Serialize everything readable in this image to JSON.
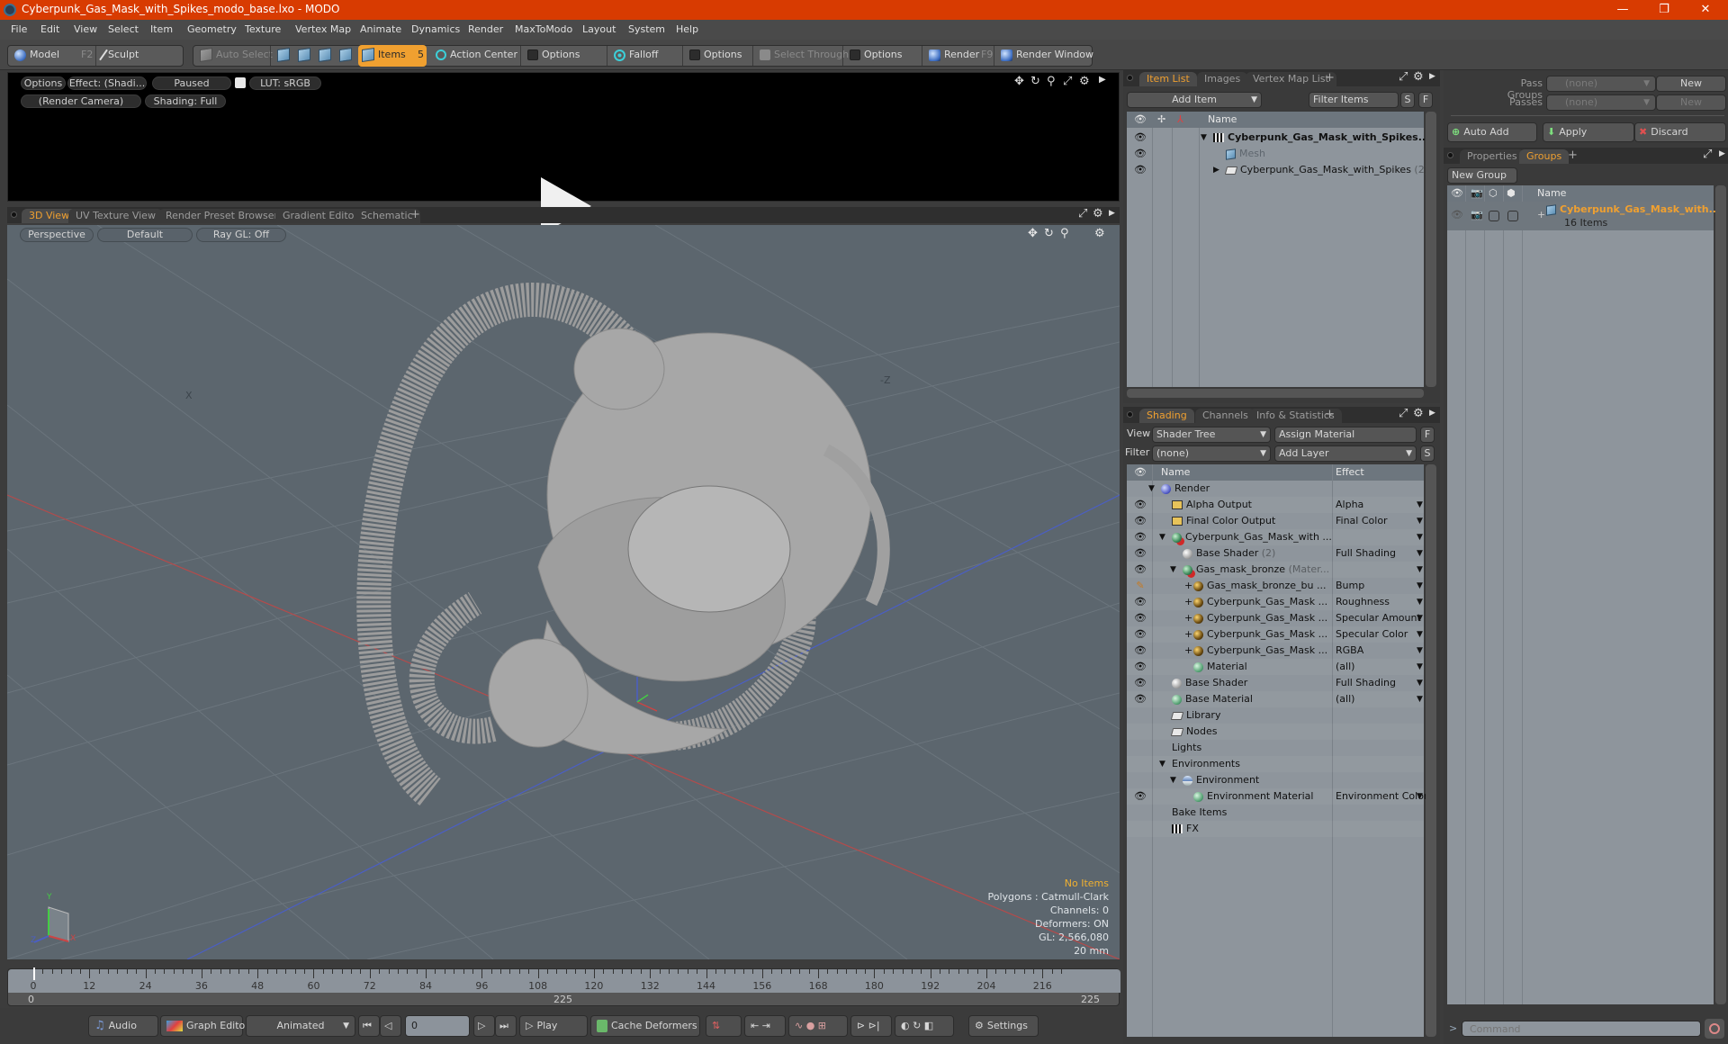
{
  "window": {
    "title": "Cyberpunk_Gas_Mask_with_Spikes_modo_base.lxo - MODO",
    "controls": {
      "minimize": "—",
      "restore": "❐",
      "close": "✕"
    }
  },
  "menu": [
    "File",
    "Edit",
    "View",
    "Select",
    "Item",
    "Geometry",
    "Texture",
    "Vertex Map",
    "Animate",
    "Dynamics",
    "Render",
    "MaxToModo",
    "Layout",
    "System",
    "Help"
  ],
  "toolbar": {
    "model": "Model",
    "model_key": "F2",
    "sculpt": "Sculpt",
    "auto_select": "Auto Select",
    "items": "Items",
    "items_count": "5",
    "action_center": "Action Center",
    "options1": "Options",
    "falloff": "Falloff",
    "options2": "Options",
    "select_through": "Select Through",
    "options3": "Options",
    "render": "Render",
    "render_key": "F9",
    "render_window": "Render Window"
  },
  "preview": {
    "options": "Options",
    "effect": "Effect: (Shadi...",
    "status": "Paused",
    "lut": "LUT: sRGB",
    "camera": "(Render Camera)",
    "shading": "Shading: Full"
  },
  "viewport_tabs": [
    "3D View",
    "UV Texture View",
    "Render Preset Browser",
    "Gradient Editor",
    "Schematic"
  ],
  "viewport": {
    "projection": "Perspective",
    "style": "Default",
    "raygl": "Ray GL: Off",
    "axis_label_neg_z": "-Z",
    "axis_label_x": "X",
    "stats": {
      "selection": "No Items",
      "polygons": "Polygons : Catmull-Clark",
      "channels": "Channels: 0",
      "deformers": "Deformers: ON",
      "gl": "GL: 2,566,080",
      "scale": "20 mm"
    },
    "gizmo": {
      "y": "Y",
      "x": "X",
      "z": "Z"
    }
  },
  "timeline": {
    "ticks": [
      "0",
      "12",
      "24",
      "36",
      "48",
      "60",
      "72",
      "84",
      "96",
      "108",
      "120",
      "132",
      "144",
      "156",
      "168",
      "180",
      "192",
      "204",
      "216"
    ],
    "range_start": "0",
    "range_end": "225",
    "current_frame": "0"
  },
  "transport": {
    "audio": "Audio",
    "graph_editor": "Graph Editor",
    "mode": "Animated",
    "frame": "0",
    "play": "Play",
    "cache_deformers": "Cache Deformers",
    "settings": "Settings"
  },
  "item_list": {
    "tabs": [
      "Item List",
      "Images",
      "Vertex Map List"
    ],
    "add_item": "Add Item",
    "filter_items": "Filter Items",
    "s_btn": "S",
    "f_btn": "F",
    "col_name": "Name",
    "rows": [
      {
        "name": "Cyberpunk_Gas_Mask_with_Spikes...",
        "bold": true
      },
      {
        "name": "Mesh",
        "dim": true
      },
      {
        "name": "Cyberpunk_Gas_Mask_with_Spikes",
        "count": "(2)"
      }
    ]
  },
  "shading": {
    "tabs": [
      "Shading",
      "Channels",
      "Info & Statistics"
    ],
    "view_label": "View",
    "view_value": "Shader Tree",
    "assign_material": "Assign Material",
    "filter_label": "Filter",
    "filter_value": "(none)",
    "add_layer": "Add Layer",
    "f_btn": "F",
    "s_btn": "S",
    "col_name": "Name",
    "col_effect": "Effect",
    "rows": [
      {
        "name": "Render",
        "effect": "",
        "icon": "blue",
        "indent": 0,
        "eye": false,
        "arrow": false
      },
      {
        "name": "Alpha Output",
        "effect": "Alpha",
        "icon": "output",
        "indent": 1,
        "eye": true,
        "arrow": true
      },
      {
        "name": "Final Color Output",
        "effect": "Final Color",
        "icon": "output",
        "indent": 1,
        "eye": true,
        "arrow": true
      },
      {
        "name": "Cyberpunk_Gas_Mask_with ...",
        "effect": "",
        "icon": "mat",
        "indent": 1,
        "eye": true,
        "arrow": true
      },
      {
        "name": "Base Shader",
        "sub": "(2)",
        "effect": "Full Shading",
        "icon": "white",
        "indent": 2,
        "eye": true,
        "arrow": true
      },
      {
        "name": "Gas_mask_bronze",
        "sub": "(Mater...",
        "effect": "",
        "icon": "mat",
        "indent": 2,
        "eye": true,
        "arrow": true
      },
      {
        "name": "Gas_mask_bronze_bu ...",
        "effect": "Bump",
        "icon": "gold",
        "indent": 3,
        "eye": "brush",
        "arrow": true
      },
      {
        "name": "Cyberpunk_Gas_Mask ...",
        "effect": "Roughness",
        "icon": "gold",
        "indent": 3,
        "eye": true,
        "arrow": true
      },
      {
        "name": "Cyberpunk_Gas_Mask ...",
        "effect": "Specular Amount",
        "icon": "gold",
        "indent": 3,
        "eye": true,
        "arrow": true
      },
      {
        "name": "Cyberpunk_Gas_Mask ...",
        "effect": "Specular Color",
        "icon": "gold",
        "indent": 3,
        "eye": true,
        "arrow": true
      },
      {
        "name": "Cyberpunk_Gas_Mask ...",
        "effect": "RGBA",
        "icon": "gold",
        "indent": 3,
        "eye": true,
        "arrow": true
      },
      {
        "name": "Material",
        "effect": "(all)",
        "icon": "green",
        "indent": 3,
        "eye": true,
        "arrow": true
      },
      {
        "name": "Base Shader",
        "effect": "Full Shading",
        "icon": "white",
        "indent": 1,
        "eye": true,
        "arrow": true
      },
      {
        "name": "Base Material",
        "effect": "(all)",
        "icon": "green",
        "indent": 1,
        "eye": true,
        "arrow": true
      },
      {
        "name": "Library",
        "effect": "",
        "icon": "folder",
        "indent": 1,
        "eye": false,
        "arrow": false
      },
      {
        "name": "Nodes",
        "effect": "",
        "icon": "folder",
        "indent": 1,
        "eye": false,
        "arrow": false
      },
      {
        "name": "Lights",
        "effect": "",
        "icon": "",
        "indent": 1,
        "eye": false,
        "arrow": false
      },
      {
        "name": "Environments",
        "effect": "",
        "icon": "",
        "indent": 1,
        "eye": false,
        "arrow": false
      },
      {
        "name": "Environment",
        "effect": "",
        "icon": "env",
        "indent": 2,
        "eye": false,
        "arrow": false
      },
      {
        "name": "Environment Material",
        "effect": "Environment Color",
        "icon": "green",
        "indent": 3,
        "eye": true,
        "arrow": true
      },
      {
        "name": "Bake Items",
        "effect": "",
        "icon": "",
        "indent": 1,
        "eye": false,
        "arrow": false
      },
      {
        "name": "FX",
        "effect": "",
        "icon": "clap",
        "indent": 1,
        "eye": false,
        "arrow": false
      }
    ]
  },
  "passes": {
    "pass_groups_label": "Pass Groups",
    "pass_groups_value": "(none)",
    "passes_label": "Passes",
    "passes_value": "(none)",
    "new": "New",
    "auto_add": "Auto Add",
    "apply": "Apply",
    "discard": "Discard"
  },
  "groups": {
    "tabs": [
      "Properties",
      "Groups"
    ],
    "new_group": "New Group",
    "col_name": "Name",
    "group_name": "Cyberpunk_Gas_Mask_with...",
    "group_count": "16 Items"
  },
  "command": {
    "placeholder": "Command",
    "prompt": ">"
  },
  "colors": {
    "accent": "#f0a030",
    "titlebar": "#d83b01"
  }
}
